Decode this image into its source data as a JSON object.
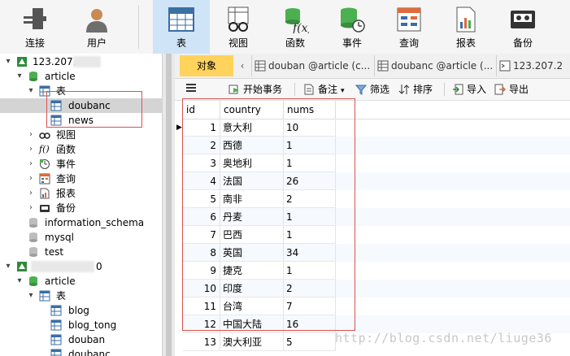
{
  "toolbar": {
    "items": [
      {
        "label": "连接",
        "icon": "plug-icon"
      },
      {
        "label": "用户",
        "icon": "user-icon"
      },
      {
        "label": "表",
        "icon": "table-icon"
      },
      {
        "label": "视图",
        "icon": "view-icon"
      },
      {
        "label": "函数",
        "icon": "function-icon"
      },
      {
        "label": "事件",
        "icon": "event-icon"
      },
      {
        "label": "查询",
        "icon": "query-icon"
      },
      {
        "label": "报表",
        "icon": "report-icon"
      },
      {
        "label": "备份",
        "icon": "backup-icon"
      }
    ],
    "active": "表"
  },
  "tree": {
    "connection1": "123.207.",
    "db_article": "article",
    "tables_folder": "表",
    "table_doubanc": "doubanc",
    "table_news": "news",
    "views": "视图",
    "functions": "函数",
    "events": "事件",
    "queries": "查询",
    "reports": "报表",
    "backups": "备份",
    "db_info_schema": "information_schema",
    "db_mysql": "mysql",
    "db_test": "test",
    "connection2_suffix": "0",
    "db_article2": "article",
    "tables_folder2": "表",
    "table_blog": "blog",
    "table_blog_tong": "blog_tong",
    "table_douban": "douban",
    "table_doubanc2": "doubanc"
  },
  "tabs": {
    "objects": "对象",
    "tab1": "douban @article (c...",
    "tab2": "doubanc @article (...",
    "tab3": "123.207.2"
  },
  "gridbar": {
    "begin_transaction": "开始事务",
    "memo": "备注",
    "filter": "筛选",
    "sort": "排序",
    "import": "导入",
    "export": "导出"
  },
  "grid": {
    "columns": [
      "id",
      "country",
      "nums"
    ],
    "rows": [
      [
        "1",
        "意大利",
        "10"
      ],
      [
        "2",
        "西德",
        "1"
      ],
      [
        "3",
        "奥地利",
        "1"
      ],
      [
        "4",
        "法国",
        "26"
      ],
      [
        "5",
        "南非",
        "2"
      ],
      [
        "6",
        "丹麦",
        "1"
      ],
      [
        "7",
        "巴西",
        "1"
      ],
      [
        "8",
        "英国",
        "34"
      ],
      [
        "9",
        "捷克",
        "1"
      ],
      [
        "10",
        "印度",
        "2"
      ],
      [
        "11",
        "台湾",
        "7"
      ],
      [
        "12",
        "中国大陆",
        "16"
      ],
      [
        "13",
        "澳大利亚",
        "5"
      ]
    ]
  },
  "watermark": "http://blog.csdn.net/liuge36",
  "colors": {
    "active_tab": "#ffd35c",
    "active_tool": "#cfe4f7",
    "highlight_box": "#d9534f",
    "tree_selected": "#d4d4d4"
  }
}
